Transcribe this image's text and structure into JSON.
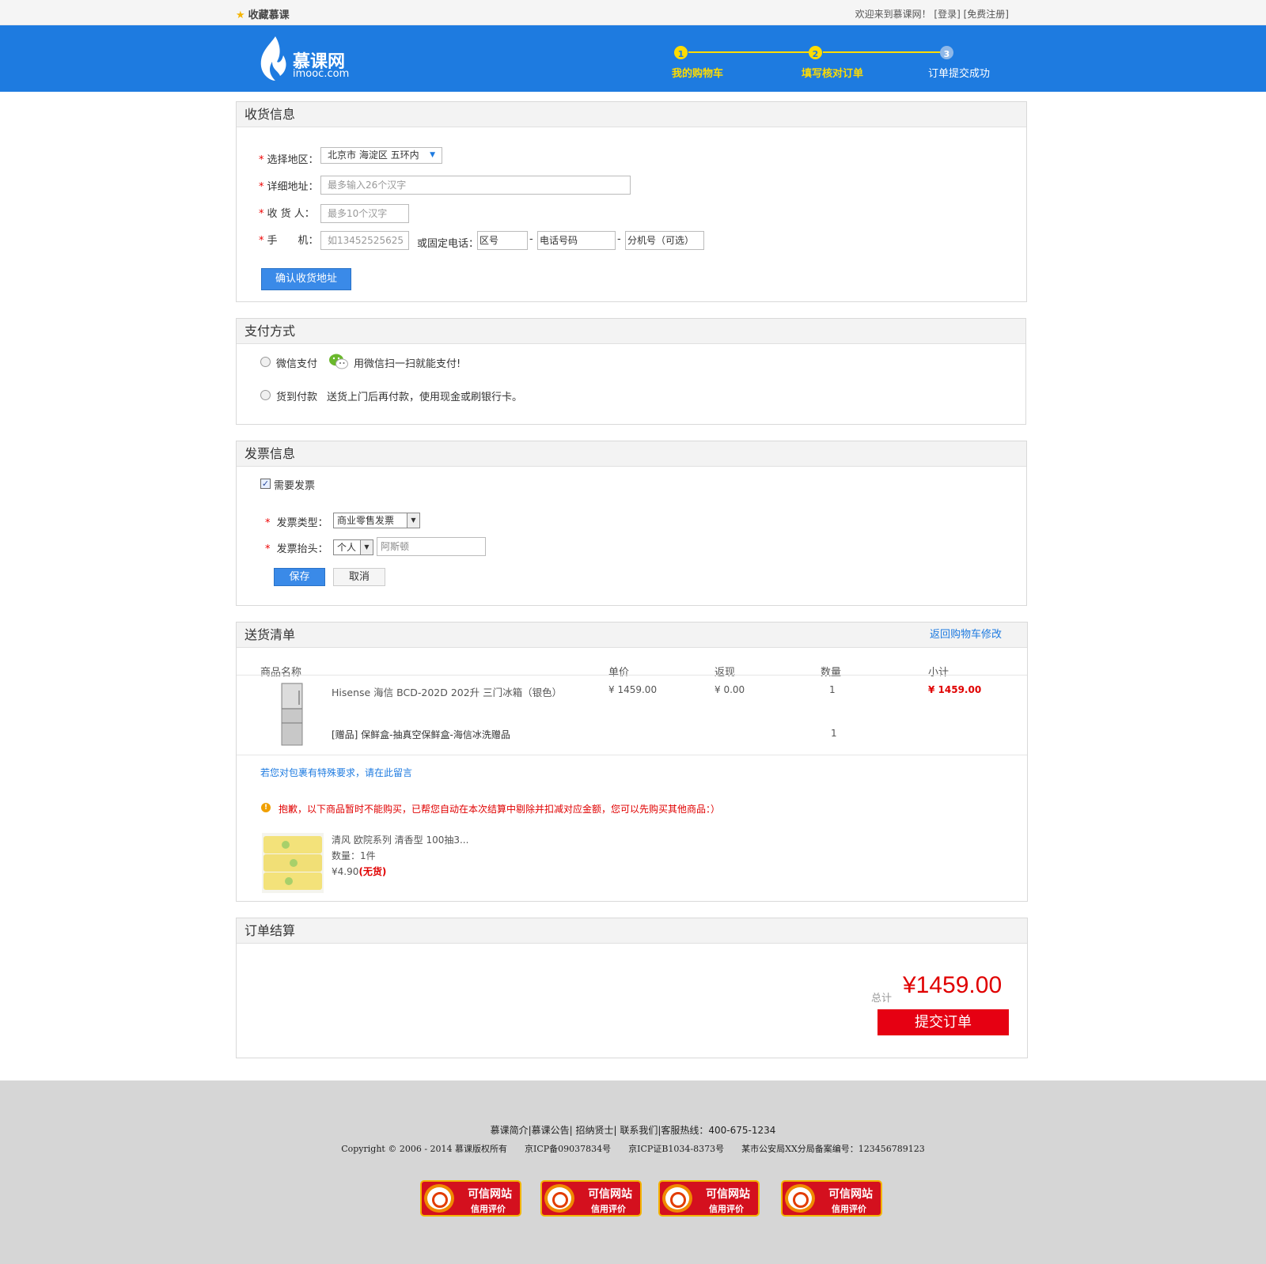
{
  "topbar": {
    "favorite": "收藏慕课",
    "welcome": "欢迎来到慕课网！",
    "login": "[登录]",
    "register": "[免费注册]"
  },
  "header": {
    "logo_cn": "慕课网",
    "logo_en": "imooc.com",
    "steps": [
      {
        "num": "1",
        "label": "我的购物车",
        "active": true
      },
      {
        "num": "2",
        "label": "填写核对订单",
        "active": true
      },
      {
        "num": "3",
        "label": "订单提交成功",
        "active": false
      }
    ]
  },
  "shipping": {
    "title": "收货信息",
    "region_label": "选择地区：",
    "region_value": "北京市 海淀区 五环内",
    "address_label": "详细地址：",
    "address_placeholder": "最多输入26个汉字",
    "receiver_label": "收 货 人：",
    "receiver_placeholder": "最多10个汉字",
    "mobile_label": "手　　机：",
    "mobile_placeholder": "如13452525625",
    "phone_label": "或固定电话：",
    "area_code": "区号",
    "phone_number": "电话号码",
    "extension": "分机号（可选）",
    "dash": "-",
    "confirm_button": "确认收货地址"
  },
  "payment": {
    "title": "支付方式",
    "options": [
      {
        "label": "微信支付",
        "desc": "用微信扫一扫就能支付!"
      },
      {
        "label": "货到付款",
        "desc": "送货上门后再付款，使用现金或刷银行卡。"
      }
    ]
  },
  "invoice": {
    "title": "发票信息",
    "need_invoice": "需要发票",
    "type_label": "发票类型：",
    "type_value": "商业零售发票",
    "header_label": "发票抬头：",
    "header_type": "个人",
    "header_name": "阿斯顿",
    "save_button": "保存",
    "cancel_button": "取消"
  },
  "delivery": {
    "title": "送货清单",
    "back_link": "返回购物车修改",
    "columns": [
      "商品名称",
      "单价",
      "返现",
      "数量",
      "小计"
    ],
    "product": {
      "name": "Hisense 海信 BCD-202D 202升 三门冰箱（银色）",
      "price": "¥ 1459.00",
      "cashback": "¥ 0.00",
      "qty": "1",
      "subtotal": "¥ 1459.00"
    },
    "gift": {
      "name": "[赠品] 保鲜盒-抽真空保鲜盒-海信冰洗赠品",
      "qty": "1"
    },
    "message_link": "若您对包裹有特殊要求，请在此留言",
    "warning": "抱歉，以下商品暂时不能购买，已帮您自动在本次结算中剔除并扣减对应金额，您可以先购买其他商品：）",
    "unavailable": {
      "name": "清风 欧院系列 清香型 100抽3...",
      "qty": "数量：1件",
      "price": "¥4.90",
      "status": "(无货)"
    }
  },
  "settlement": {
    "title": "订单结算",
    "total_label": "总计",
    "total": "¥1459.00",
    "submit_button": "提交订单"
  },
  "footer": {
    "links": "慕课简介|慕课公告| 招纳贤士| 联系我们|客服热线：400-675-1234",
    "copyright": "Copyright © 2006 - 2014 慕课版权所有　　京ICP备09037834号　　京ICP证B1034-8373号　　某市公安局XX分局备案编号：123456789123",
    "badges": [
      {
        "t1": "可信网站",
        "t2": "信用评价"
      },
      {
        "t1": "可信网站",
        "t2": "信用评价"
      },
      {
        "t1": "可信网站",
        "t2": "信用评价"
      },
      {
        "t1": "可信网站",
        "t2": "信用评价"
      }
    ]
  },
  "colors": {
    "brand_blue": "#1e7be0",
    "step_yellow": "#ffdc00",
    "price_red": "#e00000",
    "submit_red": "#e60012"
  }
}
